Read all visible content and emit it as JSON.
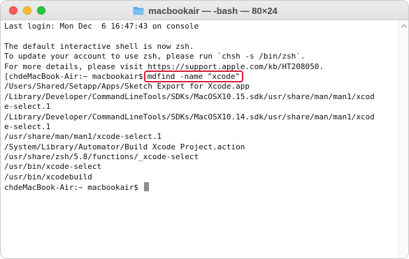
{
  "window": {
    "title": "macbookair — -bash — 80×24"
  },
  "terminal": {
    "lines": [
      "Last login: Mon Dec  6 16:47:43 on console",
      "",
      "The default interactive shell is now zsh.",
      "To update your account to use zsh, please run `chsh -s /bin/zsh`.",
      "For more details, please visit https://support.apple.com/kb/HT208050.",
      "",
      "/Users/Shared/Setapp/Apps/Sketch Export for Xcode.app",
      "/Library/Developer/CommandLineTools/SDKs/MacOSX10.15.sdk/usr/share/man/man1/xcod",
      "e-select.1",
      "/Library/Developer/CommandLineTools/SDKs/MacOSX10.14.sdk/usr/share/man/man1/xcod",
      "e-select.1",
      "/usr/share/man/man1/xcode-select.1",
      "/System/Library/Automator/Build Xcode Project.action",
      "/usr/share/zsh/5.8/functions/_xcode-select",
      "/usr/bin/xcode-select",
      "/usr/bin/xcodebuild"
    ],
    "prompt_command": {
      "prompt": "[chdeMacBook-Air:~ macbookair$",
      "command": "mdfind -name \"xcode\""
    },
    "final_prompt": "chdeMacBook-Air:~ macbookair$ "
  },
  "colors": {
    "highlight_box": "#d8203a",
    "close": "#ff5f57",
    "minimize": "#febc2e",
    "zoom": "#28c840",
    "folder": "#5aa9e6"
  },
  "icons": {
    "title": "folder-icon",
    "scroll": "chevron-up-icon"
  }
}
